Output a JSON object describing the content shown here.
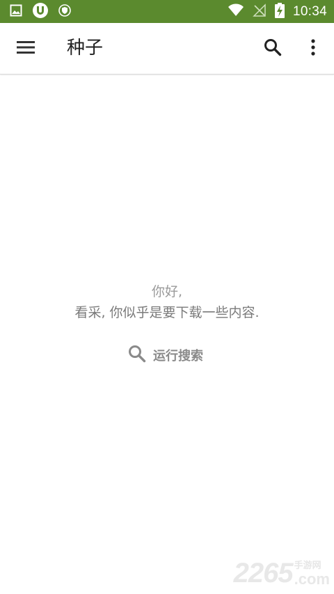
{
  "status_bar": {
    "time": "10:34",
    "left_icons": [
      "image-icon",
      "utorrent-icon",
      "shield-icon"
    ],
    "right_icons": [
      "wifi-icon",
      "no-signal-icon",
      "battery-charging-icon"
    ],
    "color": "#5b8a2e"
  },
  "toolbar": {
    "title": "种子",
    "menu_icon": "hamburger-menu-icon",
    "search_icon": "search-icon",
    "overflow_icon": "more-vert-icon"
  },
  "empty_state": {
    "greeting": "你好,",
    "message": "看采, 你似乎是要下载一些内容.",
    "action_label": "运行搜索",
    "action_icon": "search-icon"
  },
  "watermark": {
    "digits": "2265",
    "cn": "手游网",
    "suffix": ".com"
  }
}
